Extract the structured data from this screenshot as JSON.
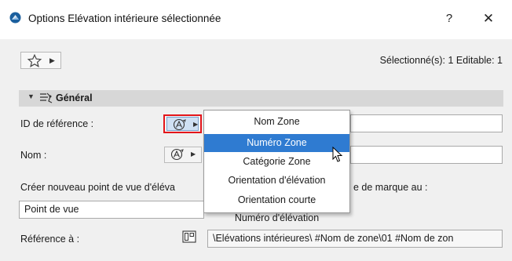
{
  "window": {
    "title": "Options Elévation intérieure sélectionnée",
    "help_label": "?",
    "close_label": "✕"
  },
  "toolbar": {
    "favorites_icon": "star-icon",
    "selection_info": "Sélectionné(s): 1 Editable: 1"
  },
  "panel": {
    "title": "Général",
    "icon": "general-settings-icon"
  },
  "fields": {
    "reference_id_label": "ID de référence :",
    "name_label": "Nom :",
    "create_label": "Créer nouveau point de vue d'éléva",
    "marker_suffix": "e de marque au :",
    "viewpoint_value": "Point de vue",
    "reference_to_label": "Référence à :",
    "reference_to_value": "\\Elévations intérieures\\  #Nom de zone\\01 #Nom de zon"
  },
  "dropdown": {
    "items": [
      "Nom Zone",
      "Numéro Zone",
      "Catégorie Zone",
      "Orientation d'élévation",
      "Orientation courte",
      "Numéro d'élévation"
    ],
    "selected": "Numéro Zone",
    "colors": {
      "highlight": "#2f7bd1",
      "outline": "#e3151a"
    }
  }
}
